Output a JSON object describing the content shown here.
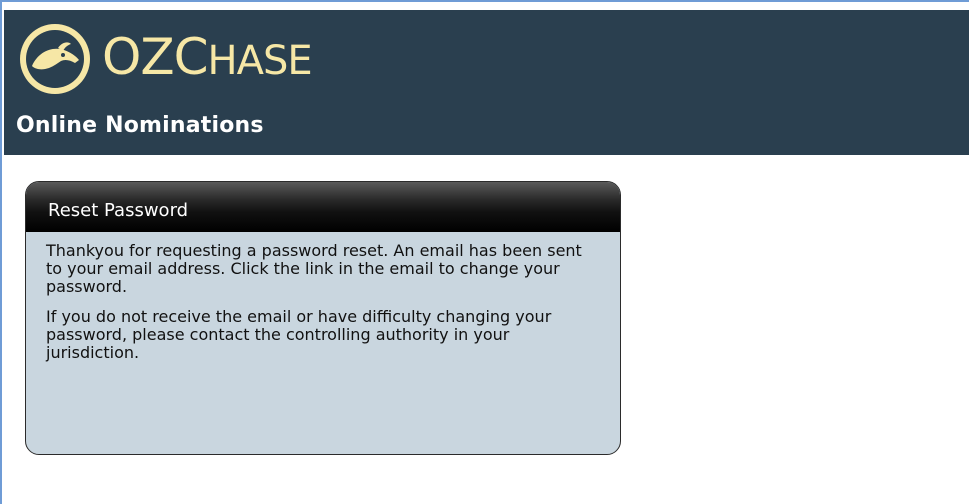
{
  "header": {
    "logo": {
      "icon": "greyhound-head-logo-icon",
      "text_big": "OZ",
      "text_cap": "C",
      "text_rest": "HASE"
    },
    "subtitle": "Online Nominations",
    "colors": {
      "bar": "#2a3f4f",
      "logo": "#f6e7a6"
    }
  },
  "panel": {
    "title": "Reset Password",
    "paragraphs": [
      "Thankyou for requesting a password reset. An email has been sent to your email address. Click the link in the email to change your password.",
      "If you do not receive the email or have difficulty changing your password, please contact the controlling authority in your jurisdiction."
    ],
    "colors": {
      "body": "#c9d6df",
      "head": "#000000"
    }
  }
}
